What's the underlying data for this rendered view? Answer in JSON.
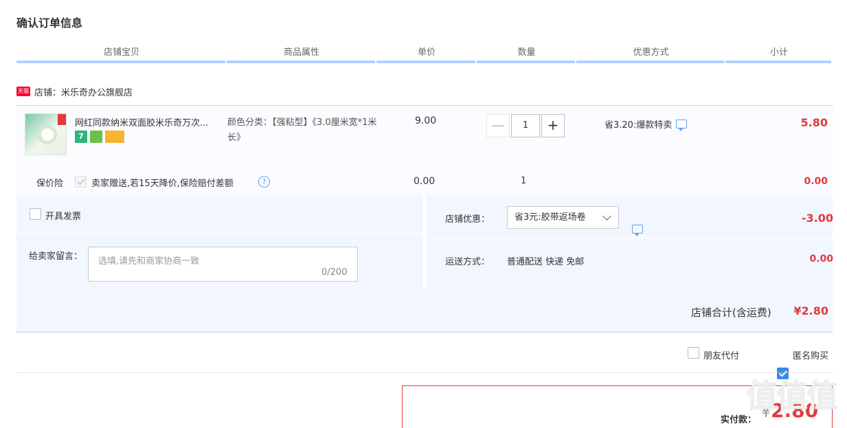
{
  "page": {
    "title": "确认订单信息"
  },
  "table_headers": [
    "店铺宝贝",
    "商品属性",
    "单价",
    "数量",
    "优惠方式",
    "小计"
  ],
  "shop": {
    "badge": "天猫",
    "label": "店铺：米乐奇办公旗舰店"
  },
  "item": {
    "name": "网红同款纳米双面胶米乐奇万次...",
    "badges": [
      "7",
      "",
      ""
    ],
    "attribute": "颜色分类：【强粘型】《3.0厘米宽*1米长》",
    "unit_price": "9.00",
    "quantity": "1",
    "qty_minus": "—",
    "qty_plus": "+",
    "promotion": "省3.20:爆款特卖",
    "subtotal": "5.80"
  },
  "insurance": {
    "label": "保价险",
    "text": "卖家赠送,若15天降价,保险赔付差额",
    "help": "?",
    "price": "0.00",
    "qty": "1",
    "subtotal": "0.00"
  },
  "invoice": {
    "label": "开具发票"
  },
  "memo": {
    "label": "给卖家留言：",
    "placeholder": "选填,请先和商家协商一致",
    "count": "0/200"
  },
  "shop_discount": {
    "label": "店铺优惠：",
    "selected": "省3元:胶带返场卷",
    "value": "-3.00"
  },
  "shipping": {
    "label": "运送方式：",
    "value": "普通配送 快递 免邮",
    "price": "0.00"
  },
  "shop_total": {
    "label": "店铺合计(含运费)",
    "value": "¥2.80"
  },
  "options": {
    "friend_pay": "朋友代付",
    "anonymous": "匿名购买",
    "anonymous_checked": true
  },
  "payment": {
    "label": "实付款：",
    "currency": "¥",
    "amount": "2.80"
  },
  "watermark": "值值值",
  "colors": {
    "price_red": "#e4393c",
    "header_line": "#b2d1ff",
    "panel_bg": "#f2f7ff",
    "checkbox_blue": "#3d8ae5"
  }
}
